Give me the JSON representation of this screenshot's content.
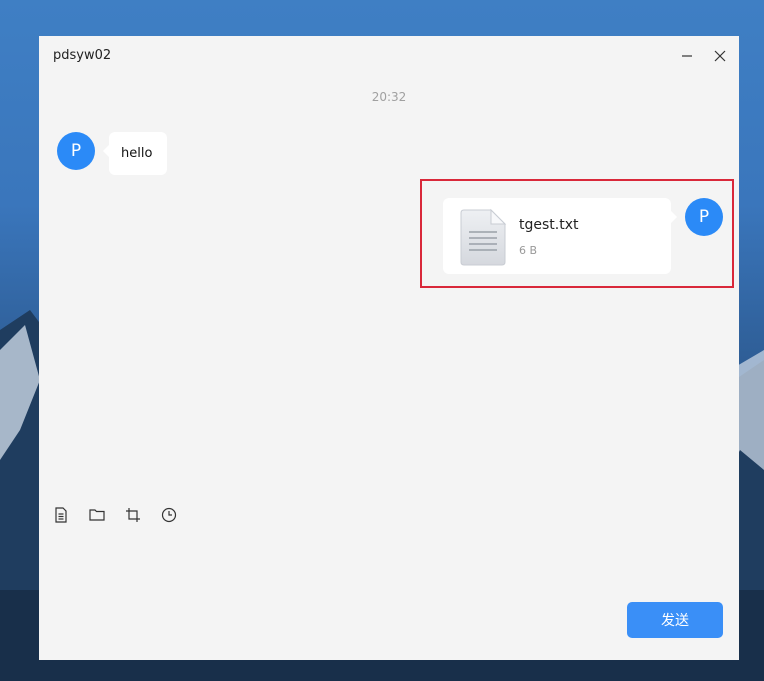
{
  "window": {
    "title": "pdsyw02",
    "minimize_icon": "minimize-icon",
    "close_icon": "close-icon"
  },
  "chat": {
    "timestamp": "20:32",
    "messages": [
      {
        "sender_initial": "P",
        "side": "left",
        "type": "text",
        "text": "hello"
      },
      {
        "sender_initial": "P",
        "side": "right",
        "type": "file",
        "file_name": "tgest.txt",
        "file_size": "6 B",
        "icon": "text-file-icon"
      }
    ]
  },
  "toolbar": {
    "icons": [
      "file-icon",
      "folder-icon",
      "crop-icon",
      "clock-icon"
    ]
  },
  "send_label": "发送",
  "colors": {
    "accent": "#2b8af7",
    "send_button": "#3a8ff7",
    "highlight_border": "#d9283a",
    "window_bg": "#f4f4f4"
  }
}
